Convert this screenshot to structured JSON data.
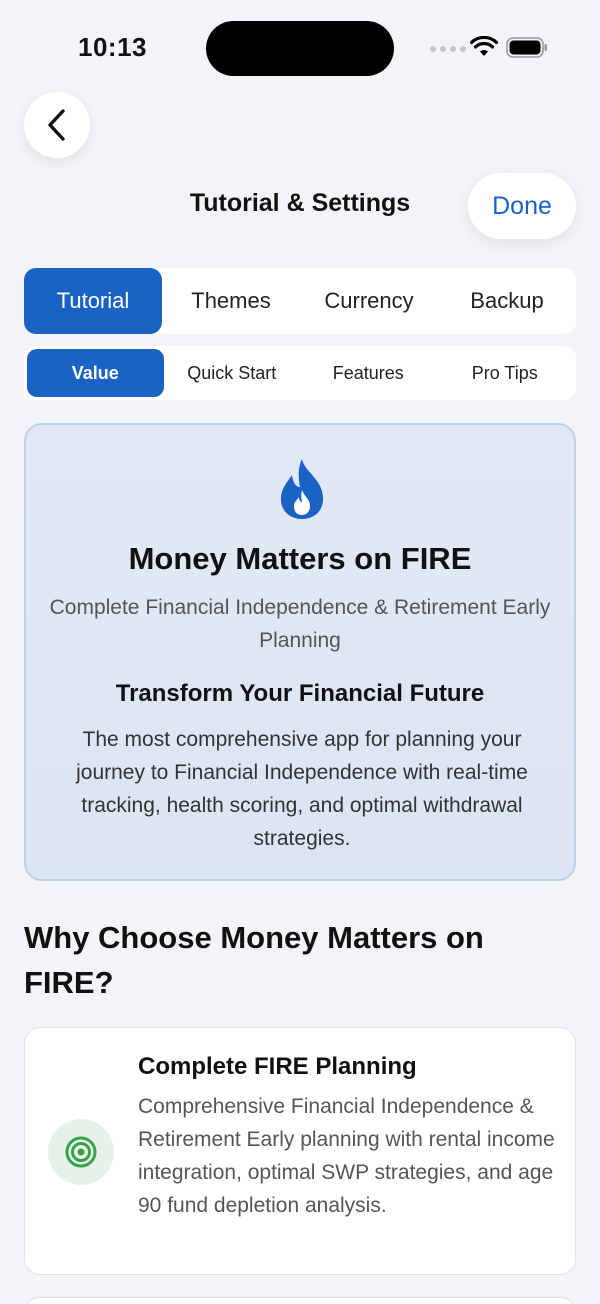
{
  "status_bar": {
    "time": "10:13"
  },
  "nav": {
    "title": "Tutorial & Settings",
    "done_label": "Done"
  },
  "main_tabs": [
    "Tutorial",
    "Themes",
    "Currency",
    "Backup"
  ],
  "main_tabs_active": "Tutorial",
  "sub_tabs": [
    "Value",
    "Quick Start",
    "Features",
    "Pro Tips"
  ],
  "sub_tabs_active": "Value",
  "hero": {
    "icon": "flame-icon",
    "title": "Money Matters on FIRE",
    "subtitle": "Complete Financial Independence & Retirement Early Planning",
    "heading": "Transform Your Financial Future",
    "description": "The most comprehensive app for planning your journey to Financial Independence with real-time tracking, health scoring, and optimal withdrawal strategies."
  },
  "section": {
    "heading": "Why Choose Money Matters on FIRE?"
  },
  "features": [
    {
      "icon": "target-icon",
      "title": "Complete FIRE Planning",
      "description": "Comprehensive Financial Independence & Retirement Early planning with rental income integration, optimal SWP strategies, and age 90 fund depletion analysis."
    }
  ],
  "colors": {
    "accent": "#1a62c4",
    "background": "#f2f4f8",
    "feature_icon": "#3aa04a"
  }
}
